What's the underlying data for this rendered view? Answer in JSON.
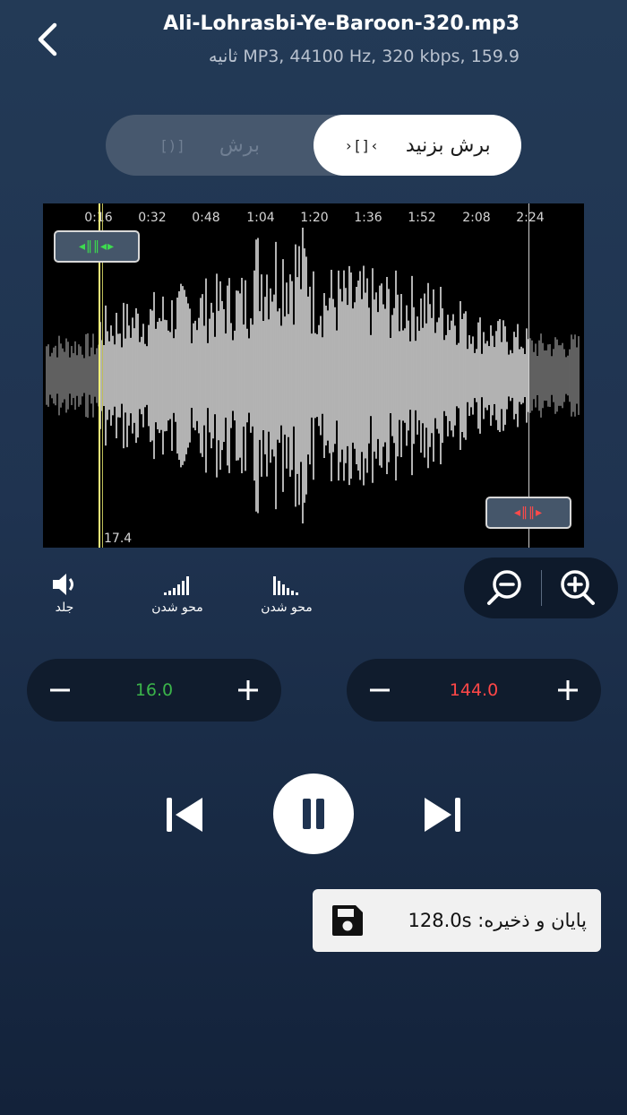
{
  "header": {
    "back_icon": "chevron-left-icon",
    "title": "Ali-Lohrasbi-Ye-Baroon-320.mp3",
    "info": "MP3, 44100 Hz, 320 kbps, 159.9 ثانیه"
  },
  "mode_toggle": {
    "left_label": "برش",
    "right_label": "برش بزنید",
    "selected": "right"
  },
  "waveform": {
    "tick_labels": [
      "0:16",
      "0:32",
      "0:48",
      "1:04",
      "1:20",
      "1:36",
      "1:52",
      "2:08",
      "2:24"
    ],
    "start_time_label": "17.4",
    "colors": {
      "selected": "#ffffff",
      "unselected": "#8a8a8a",
      "start_marker": "#f7f27a",
      "start_handle": "#3ddc4f",
      "end_handle": "#ff4a4a"
    }
  },
  "tools": {
    "volume_label": "جلد",
    "fade_in_label": "محو شدن",
    "fade_out_label": "محو شدن"
  },
  "start_stepper": {
    "value": "16.0",
    "color": "#3bb54a"
  },
  "end_stepper": {
    "value": "144.0",
    "color": "#ff4747"
  },
  "playback": {
    "state": "playing"
  },
  "save_button": {
    "label": "پایان و ذخیره: 128.0s",
    "icon": "floppy-disk-icon"
  }
}
